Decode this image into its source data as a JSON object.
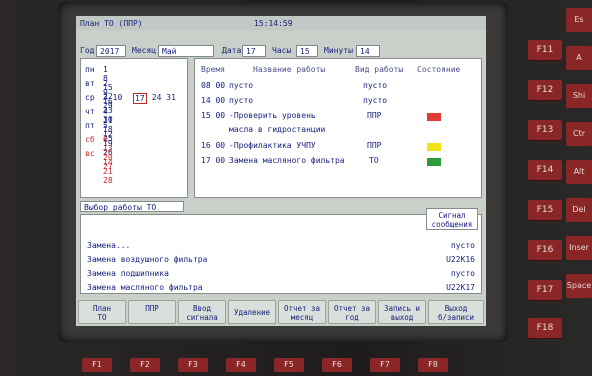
{
  "header": {
    "title": "План ТО (ППР)",
    "time": "15:14:59"
  },
  "fields": {
    "year_label": "Год",
    "year": "2017",
    "month_label": "Месяц",
    "month": "Май",
    "date_label": "Дата",
    "date": "17",
    "hours_label": "Часы",
    "hours": "15",
    "minutes_label": "Минуты",
    "minutes": "14"
  },
  "calendar": {
    "rows": [
      {
        "dow": "пн",
        "days": "1  8 15 22 29",
        "red": false
      },
      {
        "dow": "вт",
        "days": "2  9 16 23 30",
        "red": false
      },
      {
        "dow": "ср",
        "pre": "3 10 ",
        "selected": "17",
        "post": " 24 31",
        "red": false
      },
      {
        "dow": "чт",
        "days": "4 11 18 25",
        "red": false
      },
      {
        "dow": "пт",
        "days": "5 12 19 26",
        "red": false
      },
      {
        "dow": "сб",
        "days": "6 13 20 27",
        "red": true
      },
      {
        "dow": "вс",
        "days": "7 14 21 28",
        "red": true
      }
    ]
  },
  "work_table": {
    "col_time": "Время",
    "col_name": "Название работы",
    "col_type": "Вид работы",
    "col_state": "Состояние",
    "rows": [
      {
        "time": "08 00",
        "name": "пусто",
        "type": "пусто",
        "state": ""
      },
      {
        "time": "14 00",
        "name": "пусто",
        "type": "пусто",
        "state": ""
      },
      {
        "time": "15 00",
        "name": "-Проверить уровень",
        "type": "ППР",
        "state": "#e53935"
      },
      {
        "time": "",
        "name": "масла в гидростанции",
        "type": "",
        "state": ""
      },
      {
        "time": "16 00",
        "name": "-Профилактика УЧПУ",
        "type": "ППР",
        "state": "#f2e318"
      },
      {
        "time": "17 00",
        "name": "Замена масляного фильтра",
        "type": "ТО",
        "state": "#2e9b3a"
      }
    ]
  },
  "selection": {
    "title": "Выбор работы ТО",
    "signal_header_1": "Сигнал",
    "signal_header_2": "сообщения",
    "rows": [
      {
        "name": "Замена...",
        "signal": "пусто"
      },
      {
        "name": "Замена воздушного фильтра",
        "signal": "U22K16"
      },
      {
        "name": "Замена подшипника",
        "signal": "пусто"
      },
      {
        "name": "Замена масляного фильтра",
        "signal": "U22K17"
      }
    ]
  },
  "softkeys": [
    "План\nТО",
    "ППР",
    "Ввод\nсигнала",
    "Удаление",
    "Отчет за\nмесяц",
    "Отчет за\nгод",
    "Запись и\nвыход",
    "Выход\nб/записи"
  ],
  "hardkeys": {
    "right": [
      "F11",
      "F12",
      "F13",
      "F14",
      "F15",
      "F16",
      "F17",
      "F18"
    ],
    "side": [
      "Es",
      "A",
      "Shi",
      "Ctr",
      "Alt",
      "Del",
      "Inser",
      "Space"
    ],
    "bottom": [
      "F1",
      "F2",
      "F3",
      "F4",
      "F5",
      "F6",
      "F7",
      "F8"
    ]
  }
}
